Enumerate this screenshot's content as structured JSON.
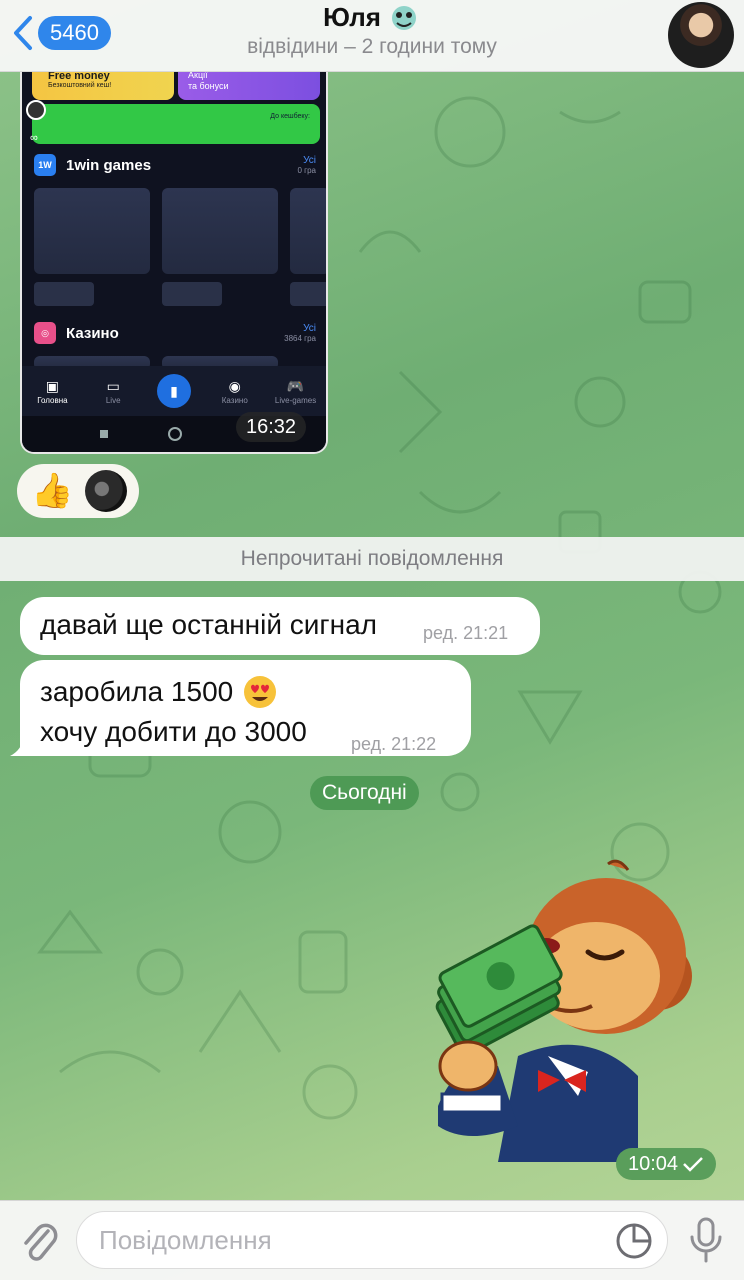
{
  "header": {
    "back_count": "5460",
    "title": "Юля",
    "status": "відвідини – 2 години тому"
  },
  "screenshot_message": {
    "promo_free_title": "Free money",
    "promo_free_sub": "Безкоштовний кеш!",
    "promo_bonus_line1": "Акції",
    "promo_bonus_line2": "та бонуси",
    "cashback_text": "До кешбеку:",
    "section_games": {
      "logo": "1W",
      "title": "1win games",
      "all": "Усі",
      "count": "0 гра"
    },
    "section_casino": {
      "title": "Казино",
      "all": "Усі",
      "count": "3864 гра"
    },
    "nav": [
      "Головна",
      "Live",
      "",
      "Казино",
      "Live-games"
    ],
    "time": "16:32"
  },
  "reactions": {
    "emoji": "👍"
  },
  "unread_divider": "Непрочитані повідомлення",
  "messages": [
    {
      "text": "давай ще останній сигнал",
      "meta": "ред. 21:21"
    },
    {
      "line1": "заробила 1500",
      "line2": "хочу добити до 3000",
      "meta": "ред. 21:22"
    }
  ],
  "date_pill": "Сьогодні",
  "sticker": {
    "time": "10:04"
  },
  "input": {
    "placeholder": "Повідомлення"
  }
}
